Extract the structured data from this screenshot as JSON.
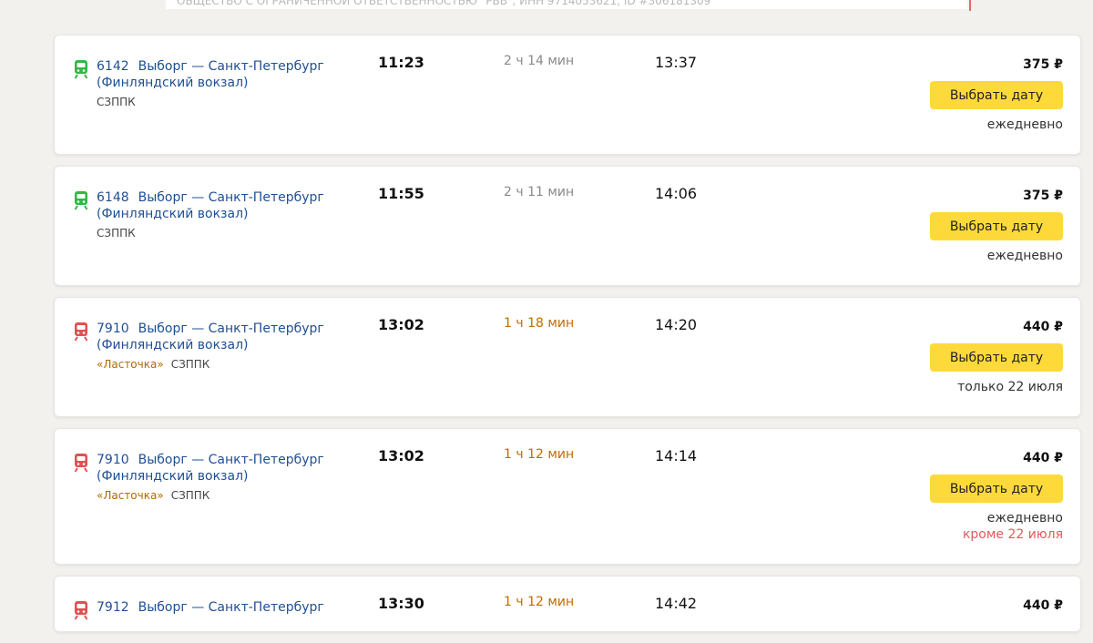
{
  "top_strip_text": "ОБЩЕСТВО С ОГРАНИЧЕННОЙ ОТВЕТСТВЕННОСТЬЮ \"РВВ\", ИНН 9714053621, ID #306181309",
  "colors": {
    "green_train": "#2fb944",
    "red_train": "#e05151",
    "button_yellow": "#fdda3a",
    "link_blue": "#1f4f96",
    "orange": "#c46b00",
    "alert_red": "#e05a5a"
  },
  "cards": [
    {
      "icon": "green-train-icon",
      "number": "6142",
      "route": "Выборг — Санкт-Петербург (Финляндский вокзал)",
      "brand": "",
      "carrier": "СЗППК",
      "departure": "11:23",
      "duration": "2 ч 14 мин",
      "duration_highlight": false,
      "arrival": "13:37",
      "price": "375 ₽",
      "button": "Выбрать дату",
      "schedule": "ежедневно",
      "schedule_note": ""
    },
    {
      "icon": "green-train-icon",
      "number": "6148",
      "route": "Выборг — Санкт-Петербург (Финляндский вокзал)",
      "brand": "",
      "carrier": "СЗППК",
      "departure": "11:55",
      "duration": "2 ч 11 мин",
      "duration_highlight": false,
      "arrival": "14:06",
      "price": "375 ₽",
      "button": "Выбрать дату",
      "schedule": "ежедневно",
      "schedule_note": ""
    },
    {
      "icon": "red-train-icon",
      "number": "7910",
      "route": "Выборг — Санкт-Петербург (Финляндский вокзал)",
      "brand": "«Ласточка»",
      "carrier": "СЗППК",
      "departure": "13:02",
      "duration": "1 ч 18 мин",
      "duration_highlight": true,
      "arrival": "14:20",
      "price": "440 ₽",
      "button": "Выбрать дату",
      "schedule": "только 22 июля",
      "schedule_note": ""
    },
    {
      "icon": "red-train-icon",
      "number": "7910",
      "route": "Выборг — Санкт-Петербург (Финляндский вокзал)",
      "brand": "«Ласточка»",
      "carrier": "СЗППК",
      "departure": "13:02",
      "duration": "1 ч 12 мин",
      "duration_highlight": true,
      "arrival": "14:14",
      "price": "440 ₽",
      "button": "Выбрать дату",
      "schedule": "ежедневно",
      "schedule_note": "кроме 22 июля"
    },
    {
      "icon": "red-train-icon",
      "number": "7912",
      "route": "Выборг — Санкт-Петербург",
      "brand": "",
      "carrier": "",
      "departure": "13:30",
      "duration": "1 ч 12 мин",
      "duration_highlight": true,
      "arrival": "14:42",
      "price": "440 ₽",
      "button": "",
      "schedule": "",
      "schedule_note": ""
    }
  ]
}
